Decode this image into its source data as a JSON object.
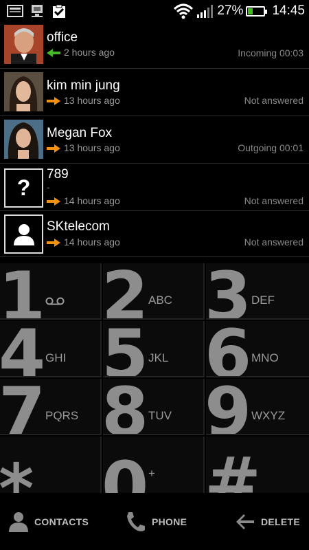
{
  "status_bar": {
    "icons": [
      "screenshot-icon",
      "sync-icon",
      "task-check-icon",
      "wifi-icon",
      "signal-icon",
      "battery-icon"
    ],
    "battery_percent": "27%",
    "battery_level": 0.27,
    "time": "14:45"
  },
  "call_log": [
    {
      "name": "office",
      "time": "2 hours ago",
      "direction": "incoming",
      "status": "Incoming 00:03",
      "avatar": "photo-man"
    },
    {
      "name": "kim min jung",
      "time": "13 hours ago",
      "direction": "outgoing",
      "status": "Not answered",
      "avatar": "photo-woman-1"
    },
    {
      "name": "Megan Fox",
      "time": "13 hours ago",
      "direction": "outgoing",
      "status": "Outgoing 00:01",
      "avatar": "photo-woman-2"
    },
    {
      "name": "789",
      "sub": "-",
      "time": "14 hours ago",
      "direction": "outgoing",
      "status": "Not answered",
      "avatar": "unknown"
    },
    {
      "name": "SKtelecom",
      "time": "14 hours ago",
      "direction": "outgoing",
      "status": "Not answered",
      "avatar": "contact-silhouette"
    }
  ],
  "dialpad": {
    "keys": [
      {
        "digit": "1",
        "letters": "",
        "icon": "voicemail-icon"
      },
      {
        "digit": "2",
        "letters": "ABC"
      },
      {
        "digit": "3",
        "letters": "DEF"
      },
      {
        "digit": "4",
        "letters": "GHI"
      },
      {
        "digit": "5",
        "letters": "JKL"
      },
      {
        "digit": "6",
        "letters": "MNO"
      },
      {
        "digit": "7",
        "letters": "PQRS"
      },
      {
        "digit": "8",
        "letters": "TUV"
      },
      {
        "digit": "9",
        "letters": "WXYZ"
      },
      {
        "digit": "*",
        "letters": ""
      },
      {
        "digit": "0",
        "letters": "+"
      },
      {
        "digit": "#",
        "letters": ""
      }
    ]
  },
  "bottom_bar": {
    "contacts_label": "CONTACTS",
    "phone_label": "PHONE",
    "delete_label": "DELETE"
  },
  "colors": {
    "incoming_arrow": "#46b92a",
    "outgoing_arrow": "#f39212",
    "battery_fill": "#3fbf1a"
  }
}
